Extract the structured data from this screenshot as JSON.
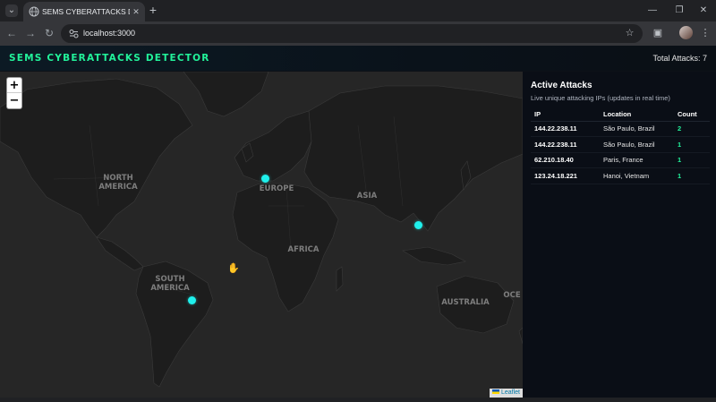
{
  "browser": {
    "tab_title": "SEMS CYBERATTACKS DETECTO",
    "url": "localhost:3000"
  },
  "header": {
    "title": "SEMS CYBERATTACKS DETECTOR",
    "total_attacks": "Total Attacks: 7",
    "accent_color": "#22f29a"
  },
  "map": {
    "zoom_in": "+",
    "zoom_out": "−",
    "attribution": "Leaflet",
    "labels": {
      "north_america": [
        "NORTH",
        "AMERICA"
      ],
      "south_america": [
        "SOUTH",
        "AMERICA"
      ],
      "europe": "EUROPE",
      "asia": "ASIA",
      "africa": "AFRICA",
      "australia": "AUSTRALIA",
      "ocean": "OCE"
    },
    "markers": [
      {
        "location": "Paris, France",
        "lat": 48.86,
        "lon": 2.35
      },
      {
        "location": "Hanoi, Vietnam",
        "lat": 21.03,
        "lon": 105.85
      },
      {
        "location": "São Paulo, Brazil",
        "lat": -23.55,
        "lon": -46.63
      }
    ],
    "marker_color": "#1ff0ec"
  },
  "sidebar": {
    "title": "Active Attacks",
    "subtitle": "Live unique attacking IPs (updates in real time)",
    "columns": [
      "IP",
      "Location",
      "Count"
    ],
    "rows": [
      {
        "ip": "144.22.238.11",
        "location": "São Paulo, Brazil",
        "count": "2"
      },
      {
        "ip": "144.22.238.11",
        "location": "São Paulo, Brazil",
        "count": "1"
      },
      {
        "ip": "62.210.18.40",
        "location": "Paris, France",
        "count": "1"
      },
      {
        "ip": "123.24.18.221",
        "location": "Hanoi, Vietnam",
        "count": "1"
      }
    ]
  }
}
